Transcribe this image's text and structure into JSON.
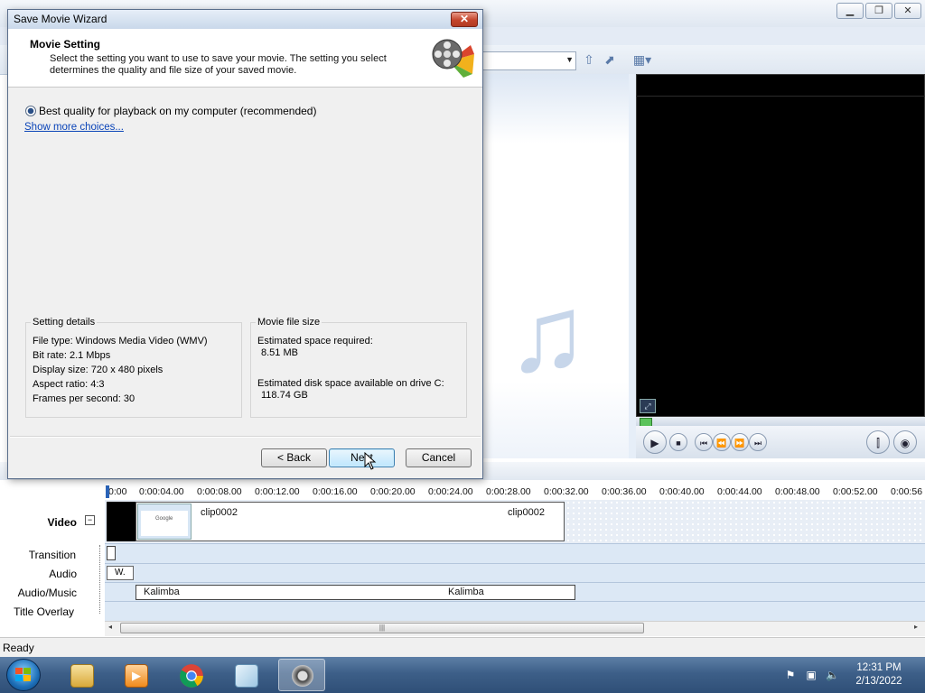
{
  "statusbar": {
    "text": "Ready"
  },
  "timeline": {
    "ruler_ticks": [
      "0:00",
      "0:00:04.00",
      "0:00:08.00",
      "0:00:12.00",
      "0:00:16.00",
      "0:00:20.00",
      "0:00:24.00",
      "0:00:28.00",
      "0:00:32.00",
      "0:00:36.00",
      "0:00:40.00",
      "0:00:44.00",
      "0:00:48.00",
      "0:00:52.00",
      "0:00:56"
    ],
    "tracks": {
      "video": "Video",
      "transition": "Transition",
      "audio": "Audio",
      "audio_music": "Audio/Music",
      "title_overlay": "Title Overlay"
    },
    "video_clip": {
      "name_left": "clip0002",
      "name_right": "clip0002",
      "thumb_text": "Google"
    },
    "audio_clip": "W.",
    "music_clip": {
      "left": "Kalimba",
      "right": "Kalimba"
    },
    "collapse_glyph": "−"
  },
  "dialog": {
    "title": "Save Movie Wizard",
    "close_glyph": "✕",
    "header_title": "Movie Setting",
    "header_description": "Select the setting you want to use to save your movie. The setting you select determines the quality and file size of your saved movie.",
    "radio_label": "Best quality for playback on my computer (recommended)",
    "more_link": "Show more choices...",
    "setting_details": {
      "title": "Setting details",
      "file_type": "File type: Windows Media Video (WMV)",
      "bit_rate": "Bit rate: 2.1 Mbps",
      "display_size": "Display size: 720 x 480 pixels",
      "aspect_ratio": "Aspect ratio: 4:3",
      "fps": "Frames per second: 30"
    },
    "movie_file_size": {
      "title": "Movie file size",
      "est_space_label": "Estimated space required:",
      "est_space_value": "8.51 MB",
      "disk_space_label": "Estimated disk space available on drive C:",
      "disk_space_value": "118.74 GB"
    },
    "buttons": {
      "back": "< Back",
      "next": "Next",
      "cancel": "Cancel"
    }
  },
  "taskbar": {
    "time": "12:31 PM",
    "date": "2/13/2022"
  },
  "colors": {
    "link": "#0a44b8",
    "taskbar": "#3d5f88",
    "close_button": "#c4452c"
  },
  "icons": [
    "windows-start-icon",
    "explorer-icon",
    "media-player-icon",
    "chrome-icon",
    "paint-icon",
    "movie-maker-icon",
    "action-center-icon",
    "network-icon",
    "volume-icon"
  ]
}
